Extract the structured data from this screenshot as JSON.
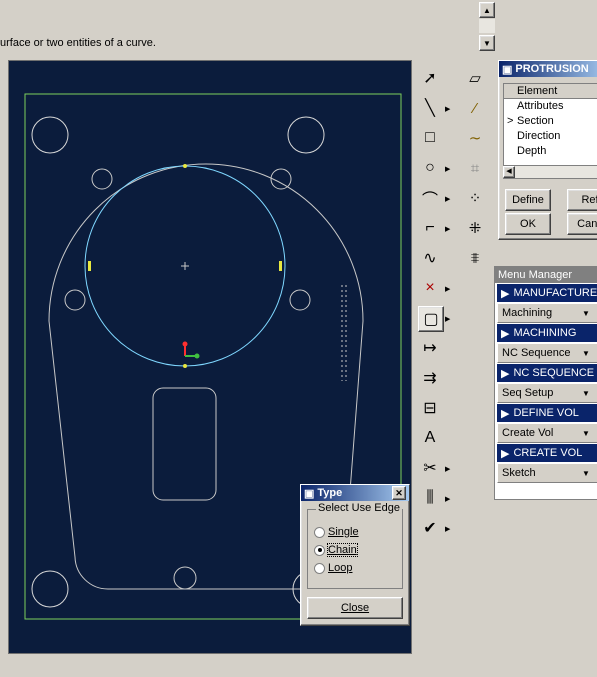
{
  "message_area": {
    "text": "urface or two entities of a curve."
  },
  "protrusion_dialog": {
    "title": "PROTRUSION",
    "column_header": "Element",
    "elements": [
      "Attributes",
      "Section",
      "Direction",
      "Depth"
    ],
    "current_element": "Section",
    "buttons": {
      "define": "Define",
      "refs": "Ref",
      "ok": "OK",
      "cancel": "Canc"
    }
  },
  "menu_manager": {
    "title": "Menu Manager",
    "sections": [
      {
        "header": "MANUFACTURE",
        "option": "Machining"
      },
      {
        "header": "MACHINING",
        "option": "NC Sequence"
      },
      {
        "header": "NC SEQUENCE",
        "option": "Seq Setup"
      },
      {
        "header": "DEFINE VOL",
        "option": "Create Vol"
      },
      {
        "header": "CREATE VOL",
        "option": "Sketch"
      }
    ]
  },
  "type_dialog": {
    "title": "Type",
    "group_label": "Select Use Edge",
    "options": [
      "Single",
      "Chain",
      "Loop"
    ],
    "selected": "Chain",
    "close_label": "Close"
  },
  "colors": {
    "canvas_bg": "#0b1c3c",
    "geometry": "#c8c8c8",
    "selected_circle": "#7fd7ff",
    "border_rect": "#7ccf5c",
    "title_bar": "#0a246a"
  }
}
